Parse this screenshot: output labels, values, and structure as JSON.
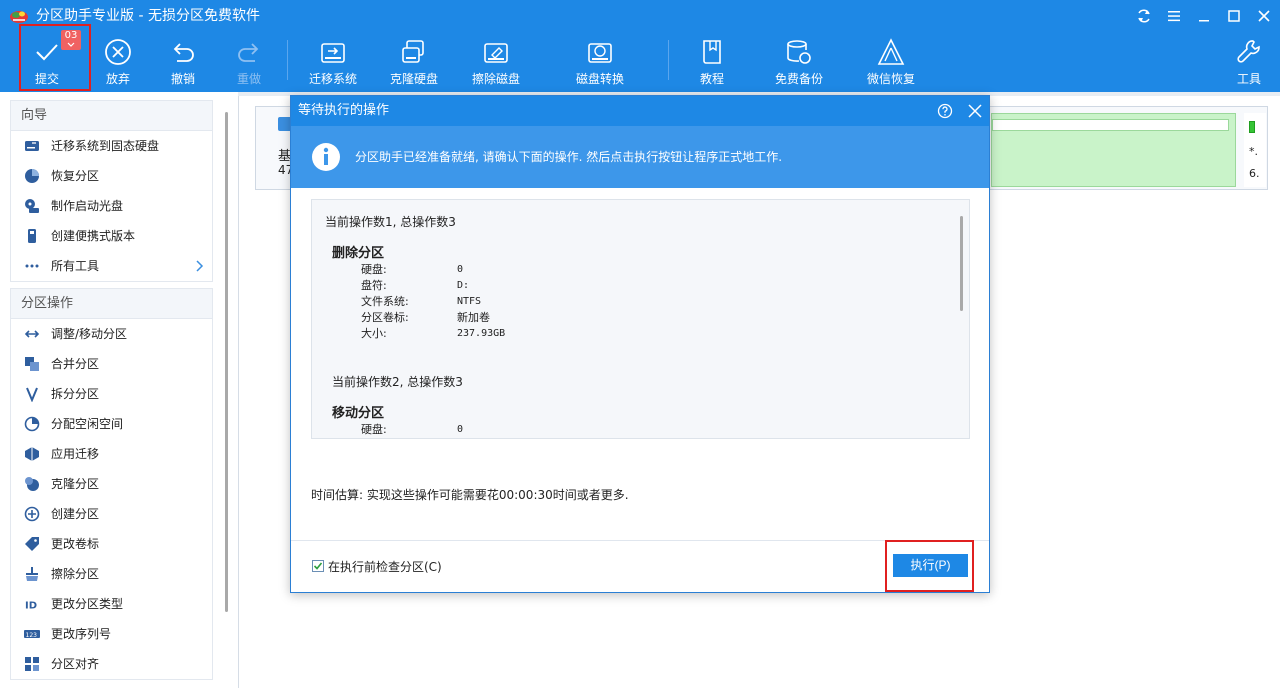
{
  "window": {
    "title": "分区助手专业版 - 无损分区免费软件"
  },
  "toolbar": {
    "submit_label": "提交",
    "submit_badge": "03",
    "discard_label": "放弃",
    "undo_label": "撤销",
    "redo_label": "重做",
    "migrate_os_label": "迁移系统",
    "clone_disk_label": "克隆硬盘",
    "wipe_disk_label": "擦除磁盘",
    "disk_convert_label": "磁盘转换",
    "tutorial_label": "教程",
    "backup_label": "免费备份",
    "wechat_recover_label": "微信恢复",
    "tools_label": "工具"
  },
  "sidebar": {
    "wizard_title": "向导",
    "wizard_items": [
      {
        "label": "迁移系统到固态硬盘",
        "icon": "migrate-icon"
      },
      {
        "label": "恢复分区",
        "icon": "recover-icon"
      },
      {
        "label": "制作启动光盘",
        "icon": "bootable-disc-icon"
      },
      {
        "label": "创建便携式版本",
        "icon": "portable-icon"
      },
      {
        "label": "所有工具",
        "icon": "more-icon"
      }
    ],
    "ops_title": "分区操作",
    "ops_items": [
      {
        "label": "调整/移动分区",
        "icon": "resize-icon"
      },
      {
        "label": "合并分区",
        "icon": "merge-icon"
      },
      {
        "label": "拆分分区",
        "icon": "split-icon"
      },
      {
        "label": "分配空闲空间",
        "icon": "allocate-icon"
      },
      {
        "label": "应用迁移",
        "icon": "app-migrate-icon"
      },
      {
        "label": "克隆分区",
        "icon": "clone-icon"
      },
      {
        "label": "创建分区",
        "icon": "create-icon"
      },
      {
        "label": "更改卷标",
        "icon": "label-icon"
      },
      {
        "label": "擦除分区",
        "icon": "wipe-icon"
      },
      {
        "label": "更改分区类型",
        "icon": "id-icon"
      },
      {
        "label": "更改序列号",
        "icon": "serial-icon"
      },
      {
        "label": "分区对齐",
        "icon": "align-icon"
      }
    ]
  },
  "main": {
    "disk_label_a": "基",
    "disk_label_b": "47",
    "right_text_1": "*.",
    "right_text_2": "6."
  },
  "dialog": {
    "title": "等待执行的操作",
    "info_text": "分区助手已经准备就绪, 请确认下面的操作. 然后点击执行按钮让程序正式地工作.",
    "ops": {
      "op1_header": "当前操作数1, 总操作数3",
      "op1_title": "删除分区",
      "op1_fields": [
        {
          "key": "硬盘:",
          "value": "0"
        },
        {
          "key": "盘符:",
          "value": "D:"
        },
        {
          "key": "文件系统:",
          "value": "NTFS"
        },
        {
          "key": "分区卷标:",
          "value": "新加卷"
        },
        {
          "key": "大小:",
          "value": "237.93GB"
        }
      ],
      "op2_header": "当前操作数2, 总操作数3",
      "op2_title": "移动分区",
      "op2_fields": [
        {
          "key": "硬盘:",
          "value": "0"
        }
      ]
    },
    "time_estimate": "时间估算: 实现这些操作可能需要花00:00:30时间或者更多.",
    "check_label": "在执行前检查分区(C)",
    "check_checked": true,
    "execute_label": "执行(P)"
  },
  "colors": {
    "accent": "#1e88e5",
    "highlight": "#e02020"
  }
}
